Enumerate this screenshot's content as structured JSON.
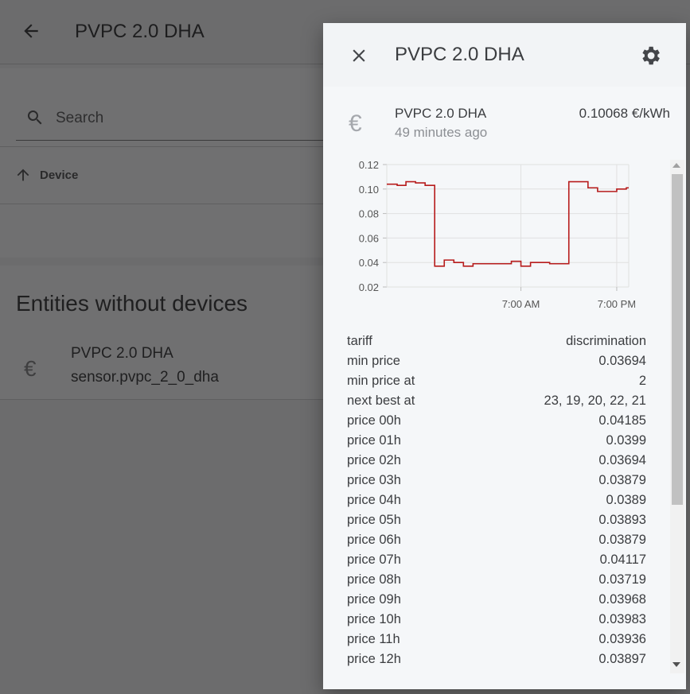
{
  "background": {
    "header_title": "PVPC 2.0 DHA",
    "search_placeholder": "Search",
    "device_column": "Device",
    "section_title": "Entities without devices",
    "entity": {
      "name": "PVPC 2.0 DHA",
      "entity_id": "sensor.pvpc_2_0_dha",
      "icon": "euro-icon"
    }
  },
  "dialog": {
    "title": "PVPC 2.0 DHA",
    "state": {
      "name": "PVPC 2.0 DHA",
      "last_changed": "49 minutes ago",
      "value": "0.10068 €/kWh",
      "icon": "euro-icon"
    },
    "attributes": [
      {
        "key": "tariff",
        "value": "discrimination"
      },
      {
        "key": "min price",
        "value": "0.03694"
      },
      {
        "key": "min price at",
        "value": "2"
      },
      {
        "key": "next best at",
        "value": "23, 19, 20, 22, 21"
      },
      {
        "key": "price 00h",
        "value": "0.04185"
      },
      {
        "key": "price 01h",
        "value": "0.0399"
      },
      {
        "key": "price 02h",
        "value": "0.03694"
      },
      {
        "key": "price 03h",
        "value": "0.03879"
      },
      {
        "key": "price 04h",
        "value": "0.0389"
      },
      {
        "key": "price 05h",
        "value": "0.03893"
      },
      {
        "key": "price 06h",
        "value": "0.03879"
      },
      {
        "key": "price 07h",
        "value": "0.04117"
      },
      {
        "key": "price 08h",
        "value": "0.03719"
      },
      {
        "key": "price 09h",
        "value": "0.03968"
      },
      {
        "key": "price 10h",
        "value": "0.03983"
      },
      {
        "key": "price 11h",
        "value": "0.03936"
      },
      {
        "key": "price 12h",
        "value": "0.03897"
      }
    ]
  },
  "colors": {
    "line": "#b71c1c",
    "grid": "#e0e0e0"
  },
  "chart_data": {
    "type": "line",
    "step": true,
    "x_ticks": [
      "7:00 AM",
      "7:00 PM"
    ],
    "y_ticks": [
      "0.12",
      "0.10",
      "0.08",
      "0.06",
      "0.04",
      "0.02"
    ],
    "ylim": [
      0.02,
      0.12
    ],
    "x_hours_range": [
      -9.8,
      20.5
    ],
    "series": [
      {
        "x_hours": [
          -9.8,
          -8.5,
          -7.4,
          -6.2,
          -5.0,
          -3.8,
          -2.6,
          -1.4,
          -0.2,
          1.0,
          2.2,
          3.4,
          4.6,
          5.8,
          7.0,
          8.2,
          9.4,
          10.6,
          11.8,
          13.0,
          14.2,
          15.4,
          16.6,
          17.8,
          19.0,
          20.2
        ],
        "y": [
          0.104,
          0.103,
          0.106,
          0.105,
          0.103,
          0.037,
          0.042,
          0.04,
          0.037,
          0.039,
          0.039,
          0.039,
          0.039,
          0.041,
          0.037,
          0.04,
          0.04,
          0.039,
          0.039,
          0.106,
          0.106,
          0.101,
          0.098,
          0.098,
          0.1,
          0.101
        ]
      }
    ]
  }
}
